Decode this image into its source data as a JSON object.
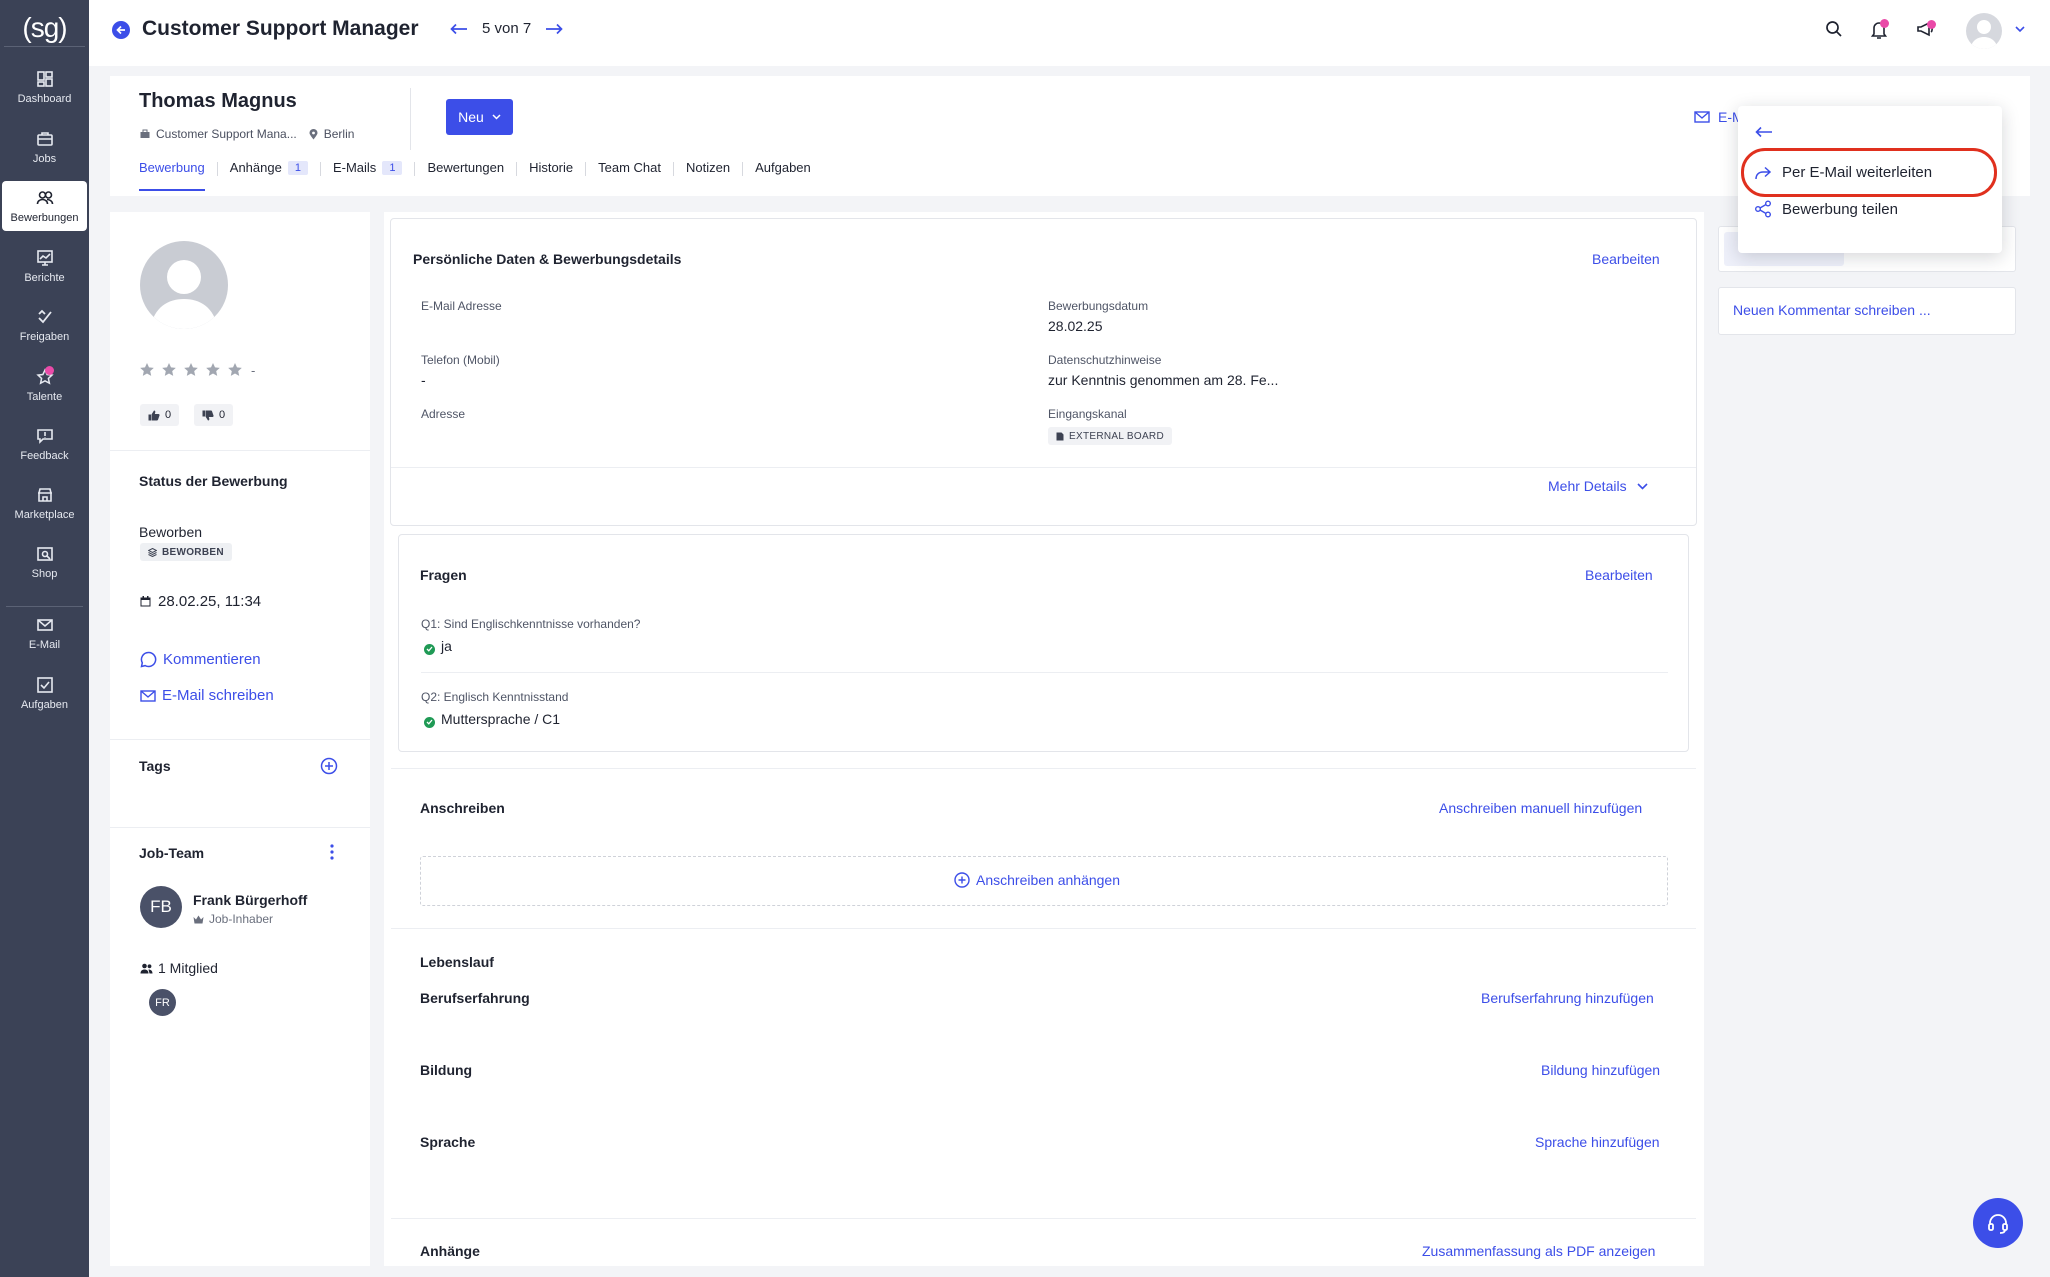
{
  "app": {
    "logo": "(sg)"
  },
  "sidebar": {
    "items": [
      {
        "label": "Dashboard",
        "icon": "dashboard-icon"
      },
      {
        "label": "Jobs",
        "icon": "briefcase-icon"
      },
      {
        "label": "Bewerbungen",
        "icon": "people-icon",
        "active": true
      },
      {
        "label": "Berichte",
        "icon": "chart-icon"
      },
      {
        "label": "Freigaben",
        "icon": "approval-icon"
      },
      {
        "label": "Talente",
        "icon": "star-icon"
      },
      {
        "label": "Feedback",
        "icon": "feedback-icon"
      },
      {
        "label": "Marketplace",
        "icon": "store-icon"
      },
      {
        "label": "Shop",
        "icon": "shop-icon"
      },
      {
        "label": "E-Mail",
        "icon": "mail-icon"
      },
      {
        "label": "Aufgaben",
        "icon": "task-icon"
      }
    ]
  },
  "header": {
    "title": "Customer Support Manager",
    "pager": "5 von 7"
  },
  "candidate": {
    "name": "Thomas Magnus",
    "job": "Customer Support Mana...",
    "location": "Berlin",
    "status_button": "Neu",
    "email_partial": "E-M"
  },
  "tabs": [
    {
      "label": "Bewerbung",
      "active": true
    },
    {
      "label": "Anhänge",
      "badge": "1"
    },
    {
      "label": "E-Mails",
      "badge": "1"
    },
    {
      "label": "Bewertungen"
    },
    {
      "label": "Historie"
    },
    {
      "label": "Team Chat"
    },
    {
      "label": "Notizen"
    },
    {
      "label": "Aufgaben"
    }
  ],
  "left": {
    "rating_dash": "-",
    "thumbs_up": "0",
    "thumbs_down": "0",
    "status_title": "Status der Bewerbung",
    "status_value": "Beworben",
    "status_chip": "BEWORBEN",
    "status_date": "28.02.25, 11:34",
    "comment_link": "Kommentieren",
    "email_link": "E-Mail schreiben",
    "tags_title": "Tags",
    "team_title": "Job-Team",
    "owner_initials": "FB",
    "owner_name": "Frank Bürgerhoff",
    "owner_role": "Job-Inhaber",
    "members_count": "1 Mitglied",
    "member_initials": "FR"
  },
  "personal": {
    "title": "Persönliche Daten & Bewerbungsdetails",
    "edit": "Bearbeiten",
    "email_label": "E-Mail Adresse",
    "phone_label": "Telefon (Mobil)",
    "phone_value": "-",
    "address_label": "Adresse",
    "date_label": "Bewerbungsdatum",
    "date_value": "28.02.25",
    "privacy_label": "Datenschutzhinweise",
    "privacy_value": "zur Kenntnis genommen am 28. Fe...",
    "channel_label": "Eingangskanal",
    "channel_value": "EXTERNAL BOARD",
    "more": "Mehr Details"
  },
  "questions": {
    "title": "Fragen",
    "edit": "Bearbeiten",
    "q1": "Q1: Sind Englischkenntnisse vorhanden?",
    "a1": "ja",
    "q2": "Q2: Englisch Kenntnisstand",
    "a2": "Muttersprache / C1"
  },
  "cover": {
    "title": "Anschreiben",
    "add_manual": "Anschreiben manuell hinzufügen",
    "attach": "Anschreiben anhängen"
  },
  "cv": {
    "title": "Lebenslauf",
    "experience": "Berufserfahrung",
    "experience_add": "Berufserfahrung hinzufügen",
    "education": "Bildung",
    "education_add": "Bildung hinzufügen",
    "language": "Sprache",
    "language_add": "Sprache hinzufügen"
  },
  "attachments": {
    "title": "Anhänge",
    "pdf": "Zusammenfassung als PDF anzeigen"
  },
  "right": {
    "comment_placeholder": "Neuen Kommentar schreiben ..."
  },
  "menu": {
    "forward": "Per E-Mail weiterleiten",
    "share": "Bewerbung teilen"
  },
  "colors": {
    "accent": "#3c4ee8",
    "sidebar": "#3b4256",
    "highlight": "#e0301e",
    "notification": "#ea4aa8"
  }
}
